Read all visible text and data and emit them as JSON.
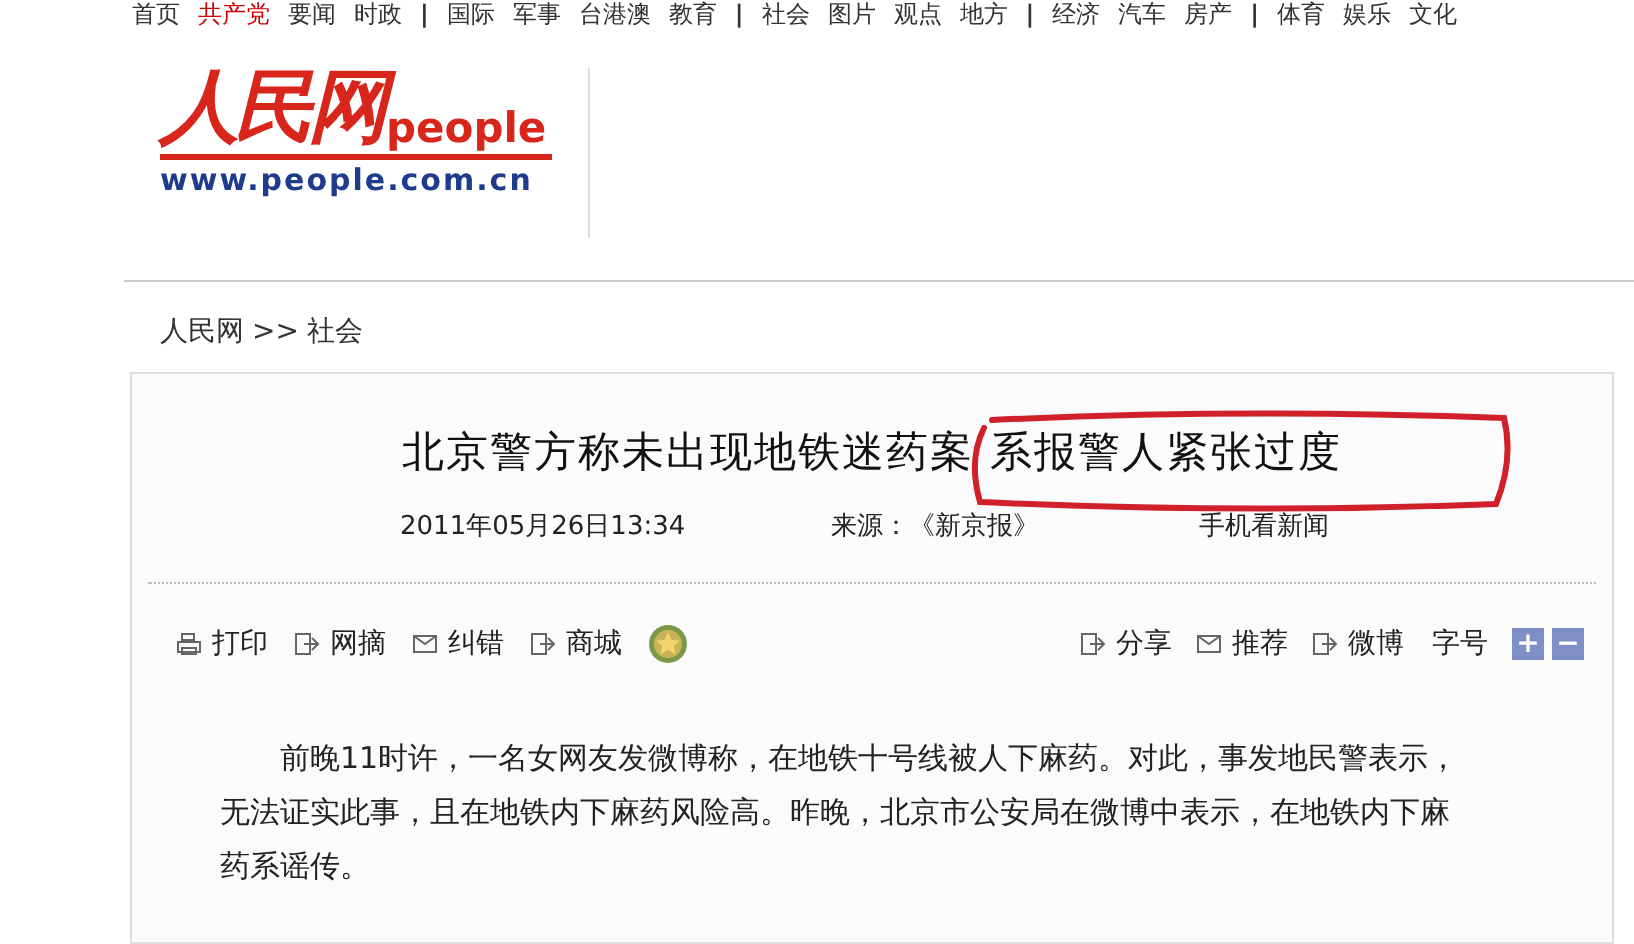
{
  "top_nav": [
    {
      "label": "首页",
      "highlighted": false
    },
    {
      "label": "共产党",
      "highlighted": true
    },
    {
      "label": "要闻",
      "highlighted": false
    },
    {
      "label": "时政",
      "highlighted": false
    },
    {
      "label": "|",
      "kind": "separator"
    },
    {
      "label": "国际",
      "highlighted": false
    },
    {
      "label": "军事",
      "highlighted": false
    },
    {
      "label": "台港澳",
      "highlighted": false
    },
    {
      "label": "教育",
      "highlighted": false
    },
    {
      "label": "|",
      "kind": "separator"
    },
    {
      "label": "社会",
      "highlighted": false
    },
    {
      "label": "图片",
      "highlighted": false
    },
    {
      "label": "观点",
      "highlighted": false
    },
    {
      "label": "地方",
      "highlighted": false
    },
    {
      "label": "|",
      "kind": "separator"
    },
    {
      "label": "经济",
      "highlighted": false
    },
    {
      "label": "汽车",
      "highlighted": false
    },
    {
      "label": "房产",
      "highlighted": false
    },
    {
      "label": "|",
      "kind": "separator"
    },
    {
      "label": "体育",
      "highlighted": false
    },
    {
      "label": "娱乐",
      "highlighted": false
    },
    {
      "label": "文化",
      "highlighted": false
    }
  ],
  "logo": {
    "mark": "人民网",
    "word": "people",
    "url": "www.people.com.cn"
  },
  "breadcrumb": [
    "人民网",
    ">>",
    "社会"
  ],
  "article": {
    "title": [
      {
        "text": "北京警方称未出现地铁迷药案",
        "circled": false
      },
      {
        "text": "系报警人紧张过度",
        "circled": true
      }
    ],
    "date": "2011年05月26日13:34",
    "source": "来源：《新京报》",
    "mobile_link": "手机看新闻",
    "tools_left": [
      {
        "kind": "print",
        "label": "打印"
      },
      {
        "kind": "share",
        "label": "网摘"
      },
      {
        "kind": "mail",
        "label": "纠错"
      },
      {
        "kind": "share",
        "label": "商城"
      },
      {
        "kind": "medal"
      }
    ],
    "tools_right": [
      {
        "kind": "share",
        "label": "分享"
      },
      {
        "kind": "mail",
        "label": "推荐"
      },
      {
        "kind": "share",
        "label": "微博"
      },
      {
        "kind": "text",
        "label": "字号"
      },
      {
        "kind": "plus",
        "label": "+"
      },
      {
        "kind": "minus",
        "label": "−"
      }
    ],
    "body": "前晚11时许，一名女网友发微博称，在地铁十号线被人下麻药。对此，事发地民警表示，无法证实此事，且在地铁内下麻药风险高。昨晚，北京市公安局在微博中表示，在地铁内下麻药系谣传。"
  }
}
